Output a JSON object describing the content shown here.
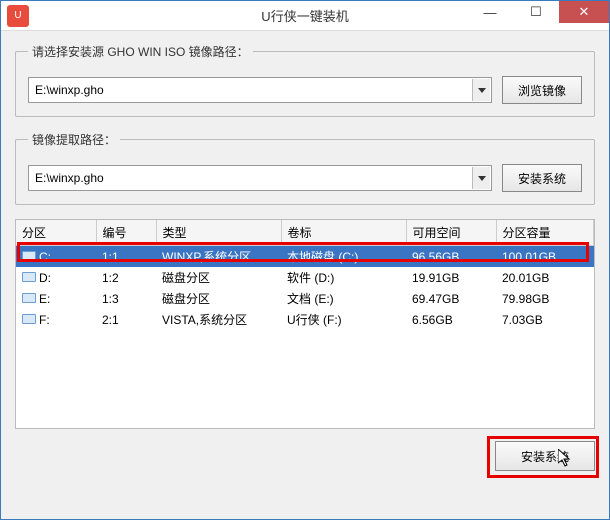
{
  "window": {
    "title": "U行侠一键装机"
  },
  "section1": {
    "legend": "请选择安装源 GHO WIN ISO 镜像路径：",
    "value": "E:\\winxp.gho",
    "browse": "浏览镜像"
  },
  "section2": {
    "legend": "镜像提取路径：",
    "value": "E:\\winxp.gho",
    "install": "安装系统"
  },
  "table": {
    "headers": [
      "分区",
      "编号",
      "类型",
      "卷标",
      "可用空间",
      "分区容量"
    ],
    "rows": [
      {
        "drive": "C:",
        "num": "1:1",
        "type": "WINXP,系统分区",
        "label": "本地磁盘 (C:)",
        "free": "96.56GB",
        "size": "100.01GB",
        "selected": true
      },
      {
        "drive": "D:",
        "num": "1:2",
        "type": "磁盘分区",
        "label": "软件 (D:)",
        "free": "19.91GB",
        "size": "20.01GB",
        "selected": false
      },
      {
        "drive": "E:",
        "num": "1:3",
        "type": "磁盘分区",
        "label": "文档 (E:)",
        "free": "69.47GB",
        "size": "79.98GB",
        "selected": false
      },
      {
        "drive": "F:",
        "num": "2:1",
        "type": "VISTA,系统分区",
        "label": "U行侠 (F:)",
        "free": "6.56GB",
        "size": "7.03GB",
        "selected": false
      }
    ]
  },
  "bottom": {
    "install": "安装系统"
  }
}
